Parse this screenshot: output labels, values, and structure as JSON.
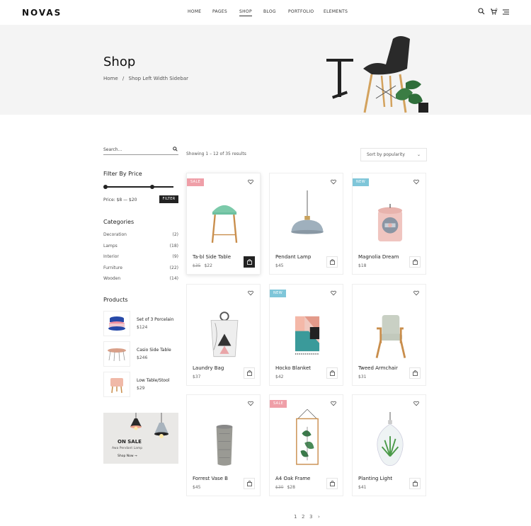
{
  "header": {
    "logo": "NOVAS",
    "nav": [
      "HOME",
      "PAGES",
      "SHOP",
      "BLOG",
      "PORTFOLIO",
      "ELEMENTS"
    ],
    "active_nav": "SHOP",
    "cart_count": "0",
    "icons": [
      "search-icon",
      "cart-icon",
      "menu-icon"
    ]
  },
  "banner": {
    "title": "Shop",
    "breadcrumb_home": "Home",
    "breadcrumb_sep": "/",
    "breadcrumb_current": "Shop Left Width Sidebar"
  },
  "sidebar": {
    "search_placeholder": "Search...",
    "filter_title": "Filter By Price",
    "price_range": "Price: $8 — $20",
    "filter_button": "FILTER",
    "categories_title": "Categories",
    "categories": [
      {
        "name": "Decoration",
        "count": "(2)"
      },
      {
        "name": "Lamps",
        "count": "(18)"
      },
      {
        "name": "Interior",
        "count": "(9)"
      },
      {
        "name": "Furniture",
        "count": "(22)"
      },
      {
        "name": "Wooden",
        "count": "(14)"
      }
    ],
    "products_title": "Products",
    "products": [
      {
        "name": "Set of 3 Porcelain",
        "price": "$124"
      },
      {
        "name": "Casio Side Table",
        "price": "$246"
      },
      {
        "name": "Low Table/Stool",
        "price": "$29"
      }
    ],
    "promo": {
      "title": "ON SALE",
      "subtitle": "Awa Pendant Lamp",
      "link": "Shop Now →"
    }
  },
  "toolbar": {
    "showing": "Showing 1 – 12 of 35 results",
    "sort": "Sort by popularity"
  },
  "products": [
    {
      "name": "Ta-bl Side Table",
      "old_price": "$35",
      "price": "$22",
      "badge": "SALE"
    },
    {
      "name": "Pendant Lamp",
      "old_price": "",
      "price": "$45",
      "badge": ""
    },
    {
      "name": "Magnolia Dream",
      "old_price": "",
      "price": "$18",
      "badge": "NEW"
    },
    {
      "name": "Laundry Bag",
      "old_price": "",
      "price": "$37",
      "badge": ""
    },
    {
      "name": "Hocko Blanket",
      "old_price": "",
      "price": "$42",
      "badge": "NEW"
    },
    {
      "name": "Tweed Armchair",
      "old_price": "",
      "price": "$31",
      "badge": ""
    },
    {
      "name": "Forrest Vase B",
      "old_price": "",
      "price": "$45",
      "badge": ""
    },
    {
      "name": "A4 Oak Frame",
      "old_price": "$30",
      "price": "$28",
      "badge": "SALE"
    },
    {
      "name": "Planting Light",
      "old_price": "",
      "price": "$41",
      "badge": ""
    }
  ],
  "pagination": [
    "1",
    "2",
    "3",
    "›"
  ],
  "colors": {
    "sale": "#ef9fa8",
    "new": "#7fc6d9",
    "accent": "#222222",
    "banner_bg": "#f4f4f4"
  }
}
